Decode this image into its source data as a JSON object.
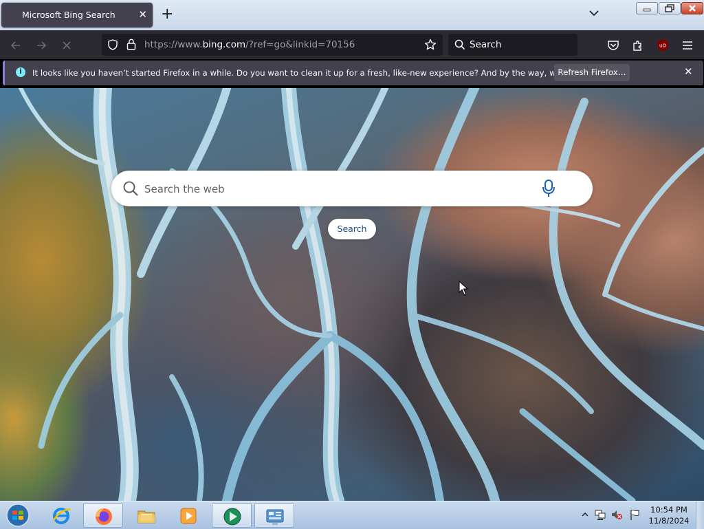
{
  "browser": {
    "tab_title": "Microsoft Bing Search",
    "url_prefix": "https://www.",
    "url_host": "bing.com",
    "url_rest": "/?ref=go&linkid=70156",
    "search_placeholder": "Search"
  },
  "notification": {
    "message": "It looks like you haven’t started Firefox in a while. Do you want to clean it up for a fresh, like-new experience? And by the way, welcome back!",
    "button_label": "Refresh Firefox…"
  },
  "bing": {
    "search_placeholder": "Search the web",
    "search_button_label": "Search"
  },
  "taskbar": {
    "items": [
      "internet-explorer",
      "firefox",
      "file-explorer",
      "media-player",
      "green-app",
      "control-panel"
    ],
    "time": "10:54 PM",
    "date": "11/8/2024"
  },
  "colors": {
    "toolbar": "#2b2a33",
    "urlbar": "#1c1b22",
    "notification": "#42414d",
    "accent": "#8f7bd8"
  }
}
